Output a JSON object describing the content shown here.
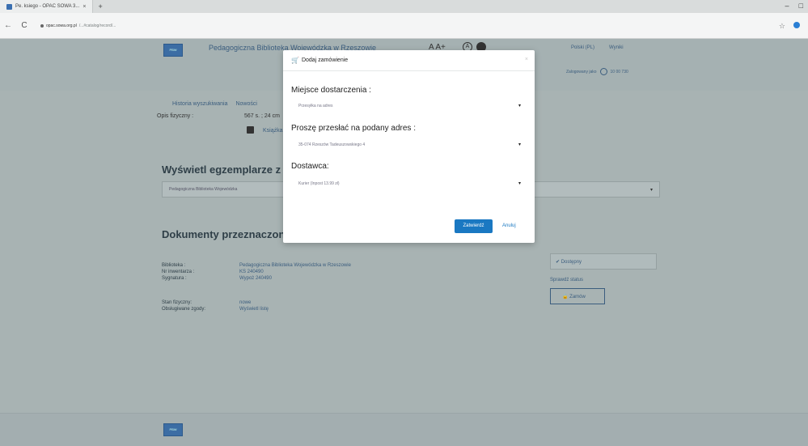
{
  "browser": {
    "tab_title": "Pe. ksiego - OPAC SOWA 3...",
    "tab_close": "×",
    "new_tab": "+",
    "url_host": "opac.sowa.org.pl",
    "url_rest": "/...#catalog/record/...",
    "back": "←",
    "reload": "C",
    "minimize": "–",
    "maximize": "□",
    "star": "☆"
  },
  "header": {
    "library_name": "Pedagogiczna Biblioteka Wojewódzka w Rzeszowie",
    "accessibility_text": "A A+",
    "contrast_letter": "A",
    "links": [
      "Polski (PL)",
      "Wyniki"
    ],
    "logged_in_label": "Zalogowany jako",
    "user_id": "10 00 730"
  },
  "record": {
    "nav_links": [
      "Historia wyszukiwania",
      "Nowości"
    ],
    "phys_label": "Opis fizyczny :",
    "phys_value": "567 s. ; 24 cm",
    "book_link": "Książka"
  },
  "copies": {
    "heading": "Wyświetl egzemplarze z w",
    "select_value": "Pedagogiczna Biblioteka Wojewódzka"
  },
  "documents": {
    "heading": "Dokumenty przeznaczone",
    "labels": [
      "Biblioteka :",
      "Nr inwentarza :",
      "Sygnatura :"
    ],
    "values": [
      "Pedagogiczna Biblioteka Wojewódzka w Rzeszowie",
      "KS 240490",
      "Wypoż 240490"
    ],
    "labels2": [
      "Stan fizyczny:",
      "Obsługiwane zgody:"
    ],
    "values2": [
      "nowe",
      "Wyświetl listę"
    ],
    "status": "✔ Dostępny",
    "check_status": "Sprawdź status",
    "order_button": "Zamów"
  },
  "modal": {
    "title": "Dodaj zamówienie",
    "close": "×",
    "delivery_label": "Miejsce dostarczenia :",
    "delivery_value": "Przesyłka na adres",
    "address_label": "Proszę przesłać na podany adres :",
    "address_value": "35-074 Rzeszów Tadeuszowskiego 4",
    "supplier_label": "Dostawca:",
    "supplier_value": "Kurier (Inpost 13.99 zł)",
    "confirm_button": "Zatwierdź",
    "cancel_link": "Anuluj"
  },
  "logo_text": "PBW",
  "colors": {
    "primary": "#1a78c2",
    "link": "#3b5d7e",
    "overlay": "#a8b3b3"
  }
}
